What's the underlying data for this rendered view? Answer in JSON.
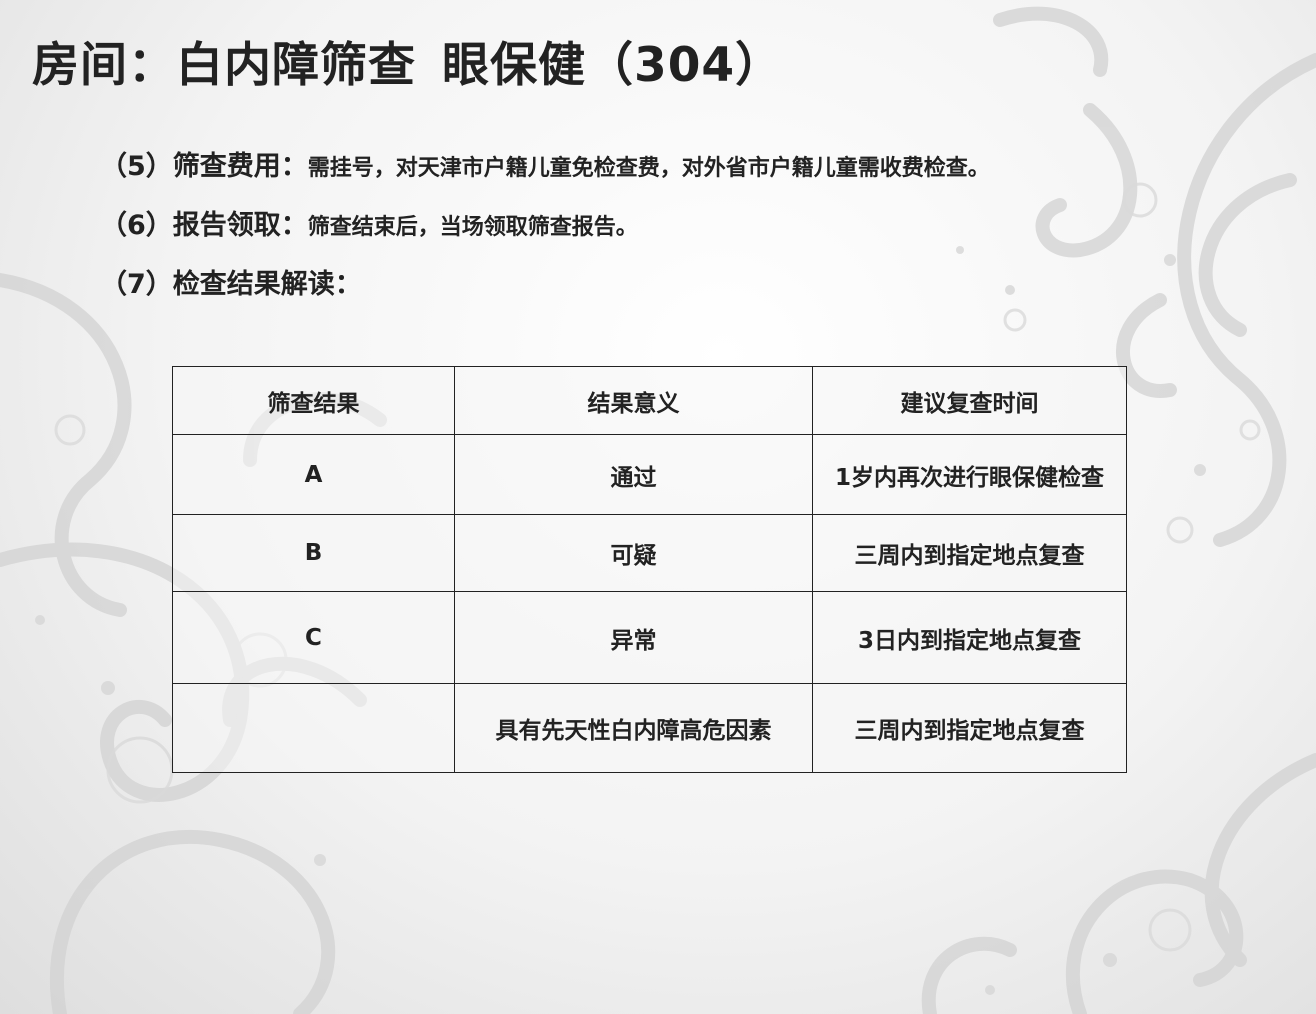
{
  "slide": {
    "title": "房间：白内障筛查",
    "title_sub": "眼保健（304）",
    "items": [
      {
        "lead": "（5）筛查费用：",
        "body": "需挂号，对天津市户籍儿童免检查费，对外省市户籍儿童需收费检查。"
      },
      {
        "lead": "（6）报告领取：",
        "body": "筛查结束后，当场领取筛查报告。"
      },
      {
        "lead": "（7）检查结果解读：",
        "body": ""
      }
    ]
  },
  "table": {
    "headers": [
      "筛查结果",
      "结果意义",
      "建议复查时间"
    ],
    "rows": [
      [
        "A",
        "通过",
        "1岁内再次进行眼保健检查"
      ],
      [
        "B",
        "可疑",
        "三周内到指定地点复查"
      ],
      [
        "C",
        "异常",
        "3日内到指定地点复查"
      ],
      [
        "",
        "具有先天性白内障高危因素",
        "三周内到指定地点复查"
      ]
    ]
  }
}
